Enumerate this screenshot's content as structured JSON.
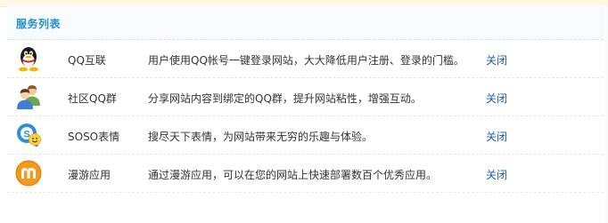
{
  "panel": {
    "title": "服务列表"
  },
  "services": [
    {
      "icon": "qq-penguin-icon",
      "name": "QQ互联",
      "description": "用户使用QQ帐号一键登录网站，大大降低用户注册、登录的门槛。",
      "action": "关闭"
    },
    {
      "icon": "community-group-icon",
      "name": "社区QQ群",
      "description": "分享网站内容到绑定的QQ群，提升网站粘性，增强互动。",
      "action": "关闭"
    },
    {
      "icon": "soso-emoticon-icon",
      "name": "SOSO表情",
      "description": "搜尽天下表情，为网站带来无穷的乐趣与体验。",
      "action": "关闭"
    },
    {
      "icon": "manyou-app-icon",
      "name": "漫游应用",
      "description": "通过漫游应用，可以在您的网站上快速部署数百个优秀应用。",
      "action": "关闭"
    }
  ],
  "colors": {
    "title": "#1e8fd0",
    "link": "#1f5fa8",
    "text": "#333333",
    "header_bg": "#f7fbff"
  }
}
